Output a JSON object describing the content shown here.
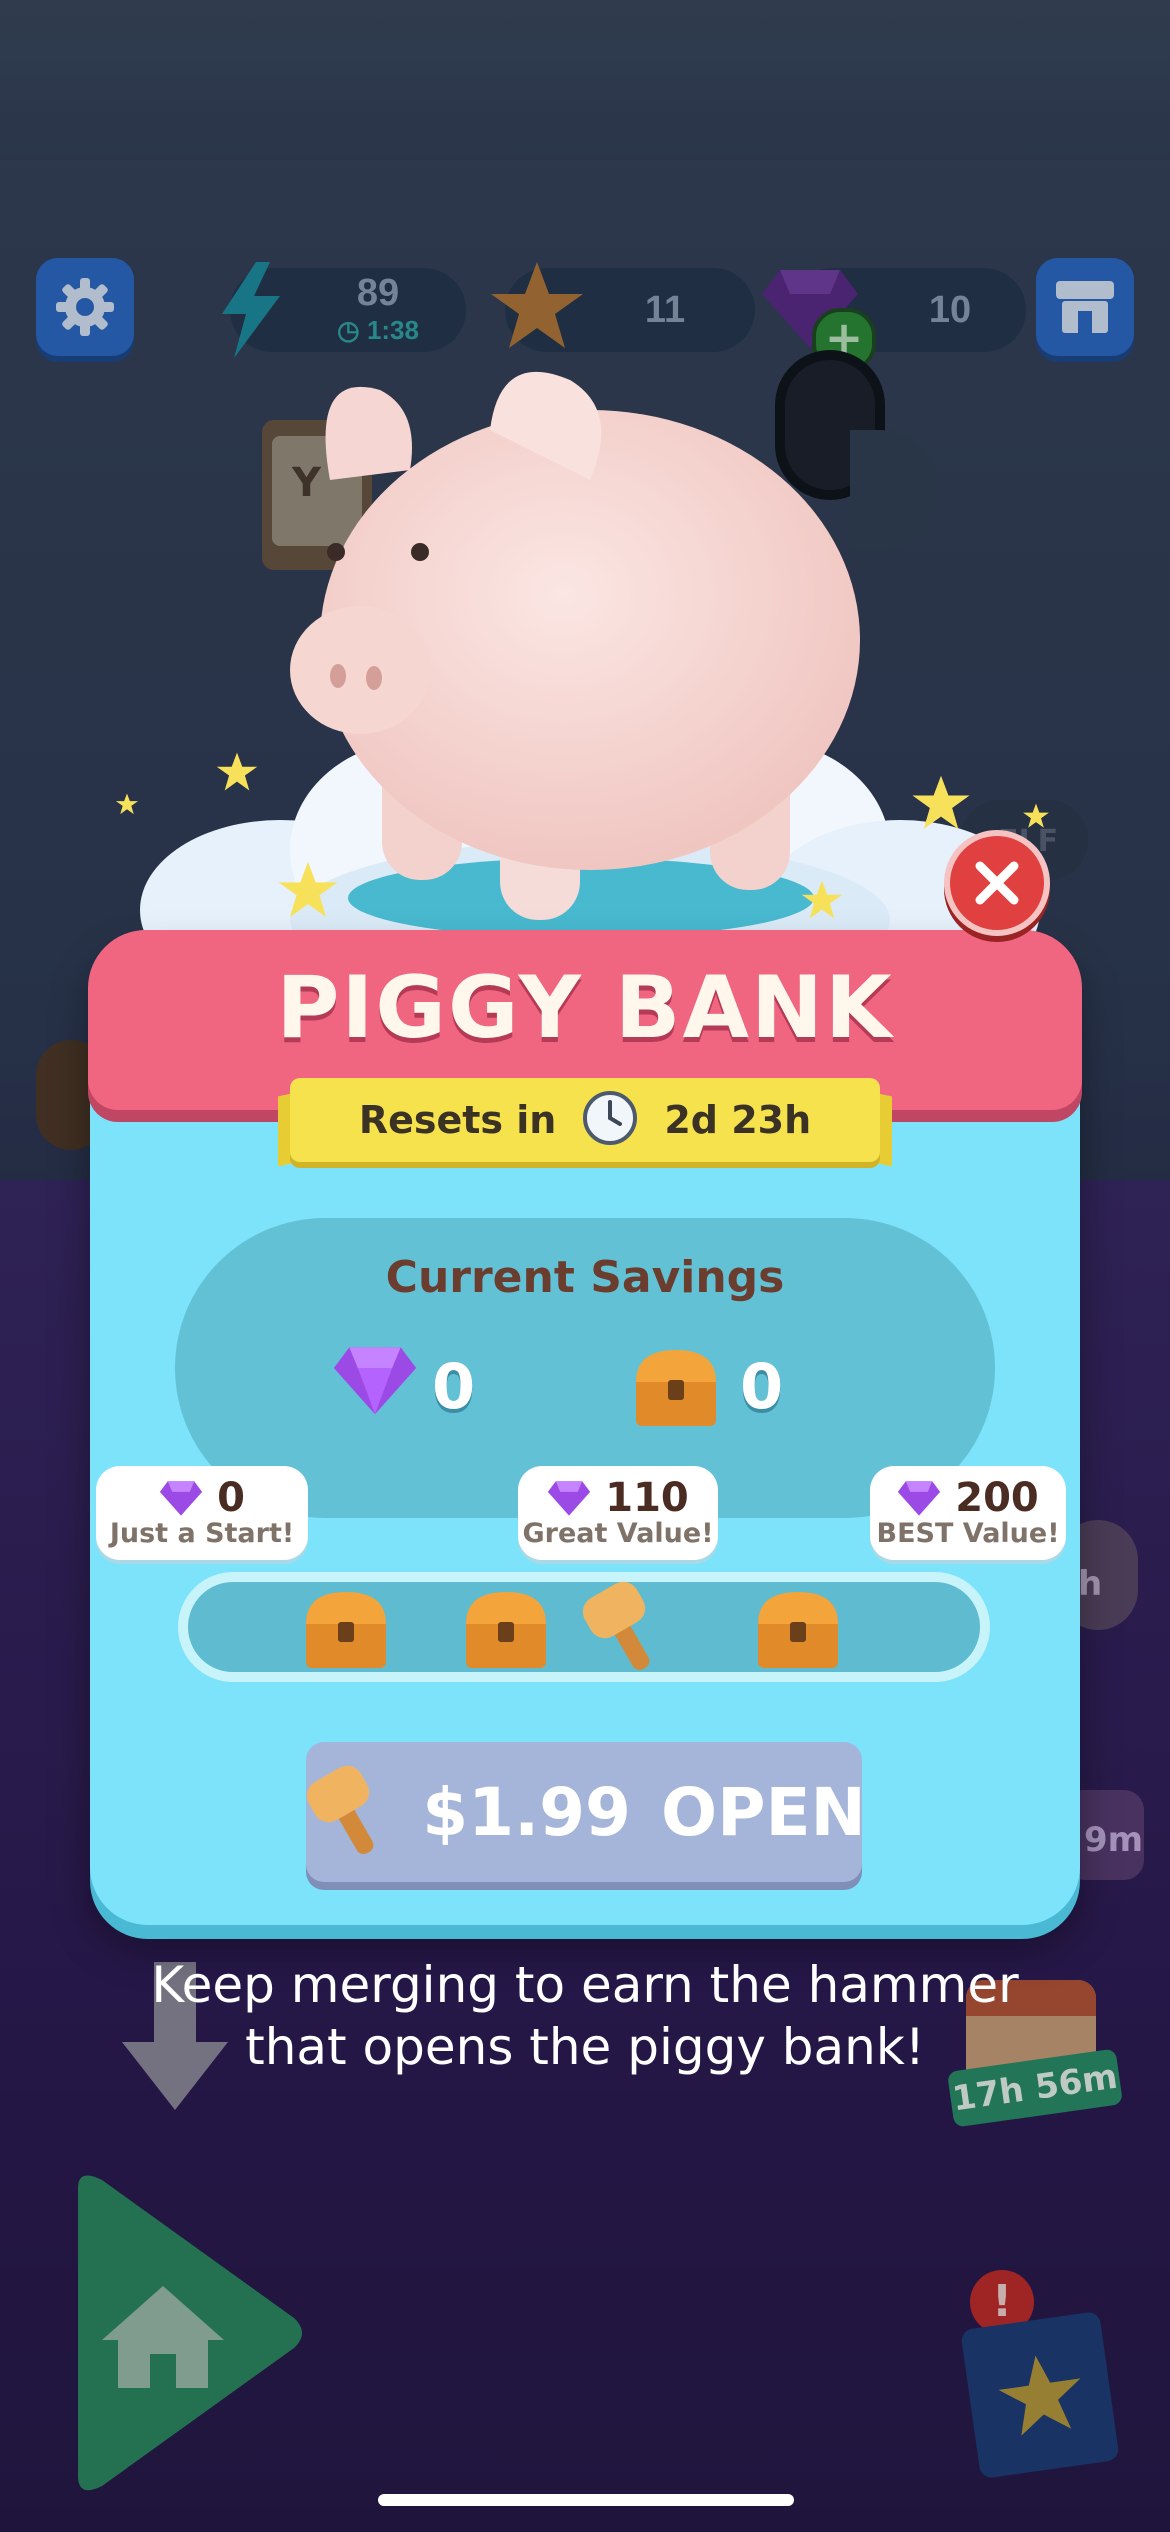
{
  "hud": {
    "energy_value": "89",
    "energy_timer": "1:38",
    "stars_value": "11",
    "gems_value": "10"
  },
  "background": {
    "sign_partial": "Y",
    "side_label_partial": "ELF",
    "side_timer_partial_1": "h",
    "side_timer_partial_2": "9m",
    "calendar_timer": "17h 56m"
  },
  "modal": {
    "title": "PIGGY BANK",
    "resets_label": "Resets in",
    "resets_time": "2d 23h",
    "current_savings_label": "Current Savings",
    "savings_gems": "0",
    "savings_chests": "0",
    "milestones": [
      {
        "value": "0",
        "label": "Just a Start!"
      },
      {
        "value": "110",
        "label": "Great Value!"
      },
      {
        "value": "200",
        "label": "BEST Value!"
      }
    ],
    "progress_fraction": 0.0,
    "open_price": "$1.99",
    "open_label": "OPEN"
  },
  "hint_line1": "Keep merging to earn the hammer",
  "hint_line2": "that opens the piggy bank!",
  "colors": {
    "banner": "#f06580",
    "modal": "#7de3fb",
    "ribbon": "#f5e24c",
    "close": "#e0403f",
    "open_button": "#a5b5d9"
  }
}
